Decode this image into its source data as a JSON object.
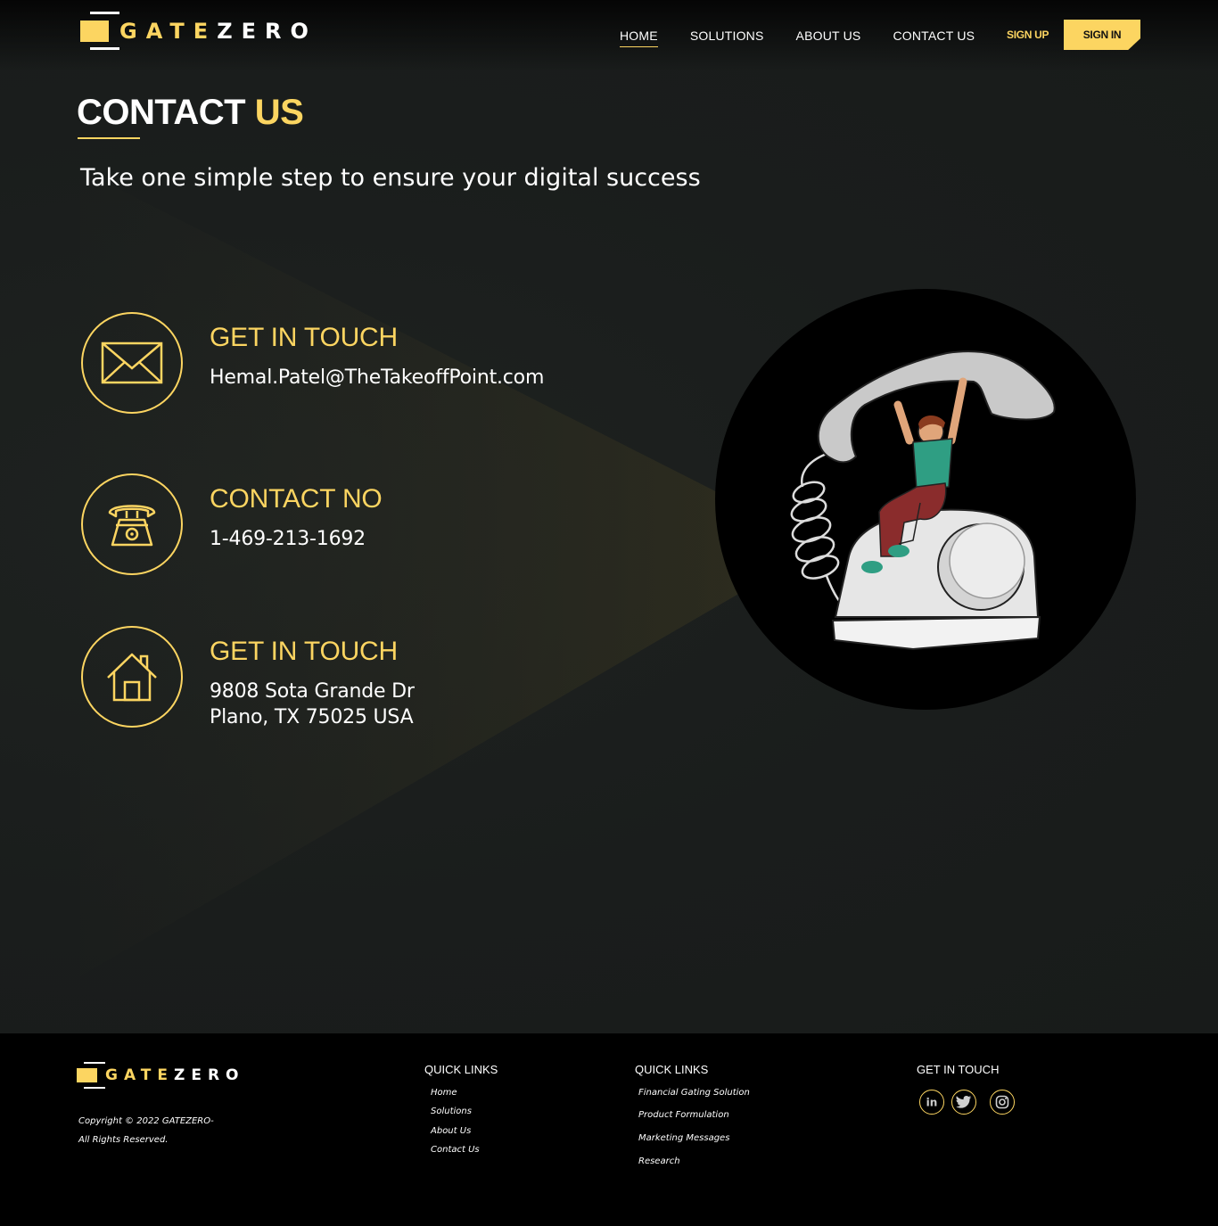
{
  "brand": {
    "logo_accent": "GATE",
    "logo_rest": "ZERO"
  },
  "nav": {
    "items": [
      {
        "label": "HOME",
        "active": true
      },
      {
        "label": "SOLUTIONS",
        "active": false
      },
      {
        "label": "ABOUT US",
        "active": false
      },
      {
        "label": "CONTACT US",
        "active": false
      }
    ],
    "signup_label": "SIGN UP",
    "signin_label": "SIGN IN"
  },
  "hero": {
    "title_white": "CONTACT",
    "title_accent": "US",
    "subtitle": "Take one simple step to ensure your digital success"
  },
  "contact": {
    "email": {
      "heading": "GET IN TOUCH",
      "value": "Hemal.Patel@TheTakeoffPoint.com",
      "icon": "envelope-icon"
    },
    "phone": {
      "heading": "CONTACT NO",
      "value": "1-469-213-1692",
      "icon": "telephone-icon"
    },
    "address": {
      "heading": "GET IN TOUCH",
      "line1": "9808 Sota Grande Dr",
      "line2": "Plano, TX 75025 USA",
      "icon": "house-icon"
    }
  },
  "footer": {
    "copyright_line1": "Copyright © 2022 GATEZERO-",
    "copyright_line2": "All Rights Reserved.",
    "col1": {
      "title": "QUICK LINKS",
      "links": [
        "Home",
        "Solutions",
        "About Us",
        "Contact Us"
      ]
    },
    "col2": {
      "title": "QUICK LINKS",
      "links": [
        "Financial Gating Solution",
        "Product Formulation",
        "Marketing Messages",
        "Research"
      ]
    },
    "col3": {
      "title": "GET IN TOUCH",
      "socials": [
        "linkedin-icon",
        "twitter-icon",
        "instagram-icon"
      ]
    }
  },
  "colors": {
    "accent": "#fcd561",
    "page_bg": "#1a1d1c",
    "footer_bg": "#000000"
  }
}
